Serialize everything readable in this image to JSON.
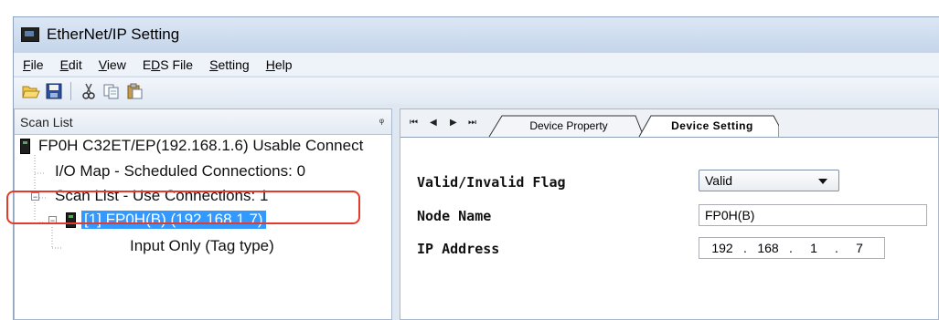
{
  "window": {
    "title": "EtherNet/IP Setting"
  },
  "menu": [
    {
      "prefix": "",
      "key": "F",
      "rest": "ile"
    },
    {
      "prefix": "",
      "key": "E",
      "rest": "dit"
    },
    {
      "prefix": "",
      "key": "V",
      "rest": "iew"
    },
    {
      "prefix": "E",
      "key": "D",
      "rest": "S File"
    },
    {
      "prefix": "",
      "key": "S",
      "rest": "etting"
    },
    {
      "prefix": "",
      "key": "H",
      "rest": "elp"
    }
  ],
  "toolbar": {
    "icons": [
      "open-folder-icon",
      "save-icon",
      "cut-icon",
      "copy-icon",
      "paste-icon"
    ]
  },
  "scan_list": {
    "title": "Scan List",
    "pin": "ᵠ",
    "root": "FP0H C32ET/EP(192.168.1.6)  Usable Connect",
    "io_map": "I/O Map - Scheduled Connections: 0",
    "scan_list_node": "Scan List - Use Connections: 1",
    "device": "[1]  FP0H(B) (192.168.1.7)",
    "input_only": "Input Only (Tag type)"
  },
  "tabs": {
    "nav": [
      "⏮",
      "◀",
      "▶",
      "⏭"
    ],
    "device_property": "Device Property",
    "device_setting": "Device Setting"
  },
  "form": {
    "valid_label": "Valid/Invalid Flag",
    "valid_value": "Valid",
    "node_name_label": "Node Name",
    "node_name_value": "FP0H(B)",
    "ip_label": "IP Address",
    "ip": [
      "192",
      "168",
      "1",
      "7"
    ]
  },
  "colors": {
    "selection": "#3399ff",
    "highlight_box": "#e23b2e"
  }
}
